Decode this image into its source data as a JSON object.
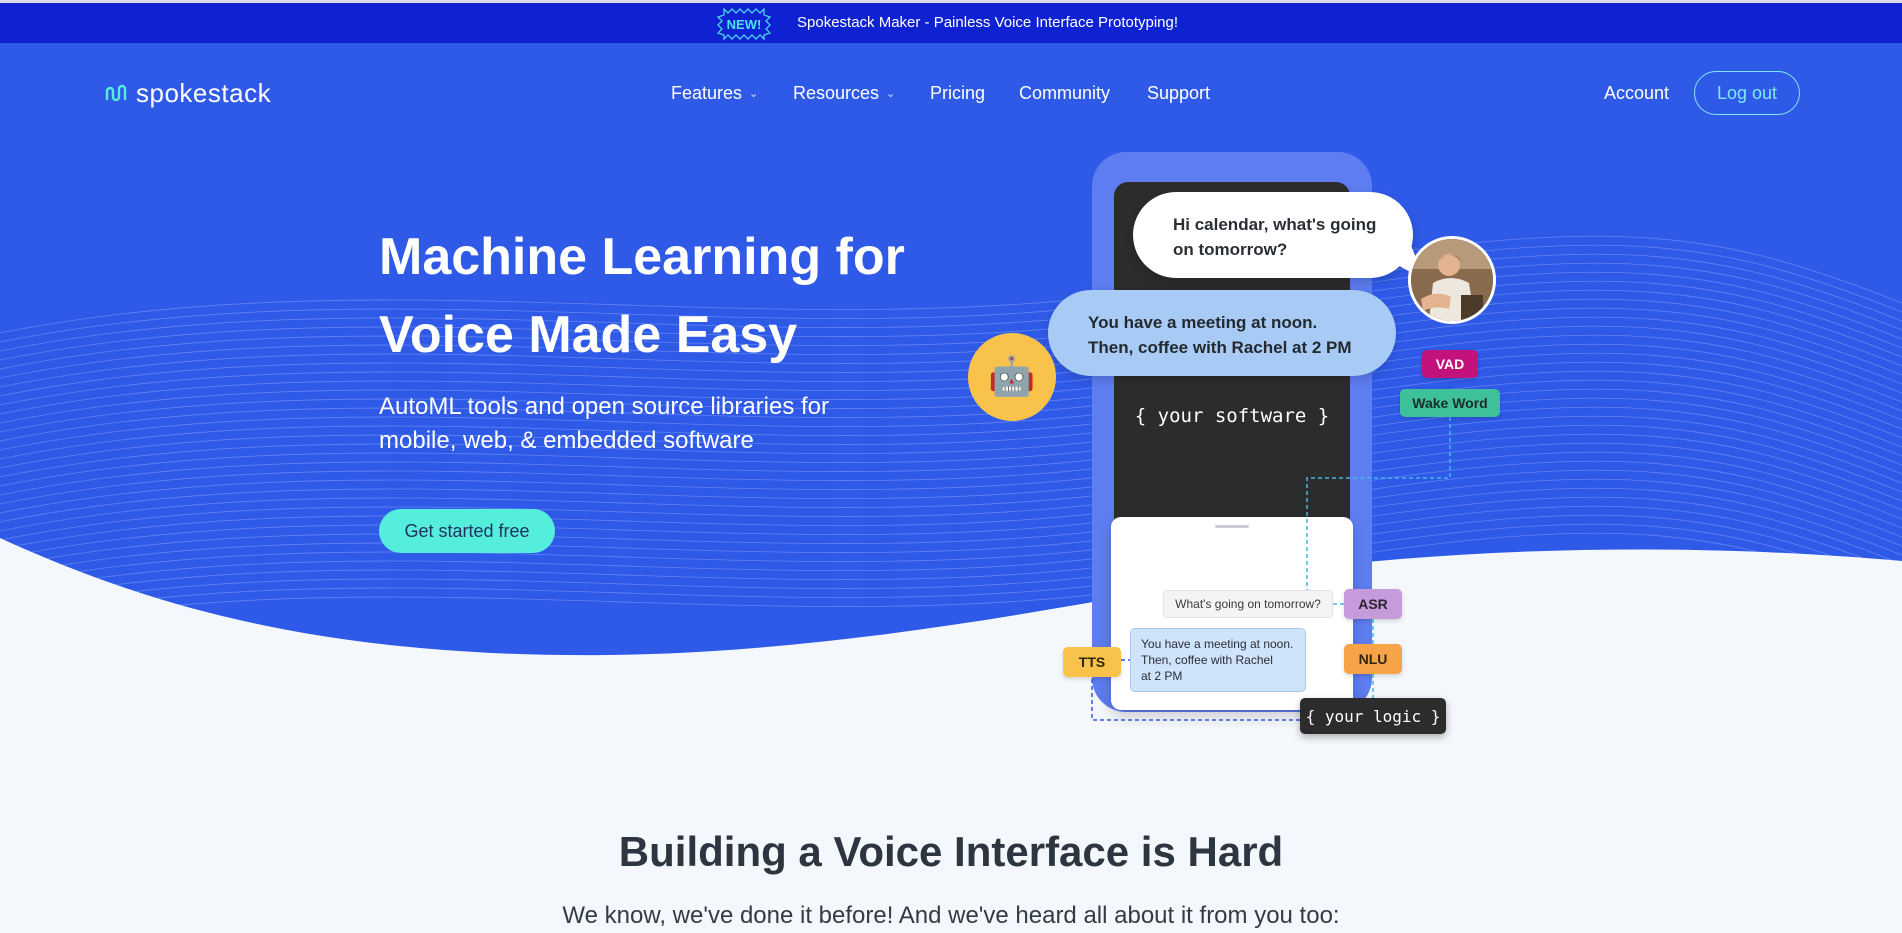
{
  "announcement": {
    "badge": "NEW!",
    "message": "Spokestack Maker - Painless Voice Interface Prototyping!"
  },
  "brand": {
    "name": "spokestack"
  },
  "nav": {
    "items": [
      {
        "label": "Features",
        "dropdown": true
      },
      {
        "label": "Resources",
        "dropdown": true
      },
      {
        "label": "Pricing",
        "dropdown": false
      },
      {
        "label": "Community",
        "dropdown": false
      },
      {
        "label": "Support",
        "dropdown": false
      }
    ],
    "account": "Account",
    "logout": "Log out",
    "chevron": "⌄"
  },
  "hero": {
    "title_line1": "Machine Learning for",
    "title_line2": "Voice Made Easy",
    "subtitle_line1": "AutoML tools and open source libraries for",
    "subtitle_line2": "mobile, web, & embedded software",
    "cta": "Get started free"
  },
  "illustration": {
    "user_bubble_line1": "Hi calendar, what's going",
    "user_bubble_line2": "on tomorrow?",
    "bot_bubble_line1": "You have a meeting at noon.",
    "bot_bubble_line2": "Then, coffee with Rachel at 2 PM",
    "software_label": "{ your software }",
    "chat_question": "What's going on tomorrow?",
    "chat_answer_line1": "You have a meeting at noon.",
    "chat_answer_line2": "Then, coffee with Rachel",
    "chat_answer_line3": "at 2 PM",
    "logic_label": "{ your logic }",
    "bot_avatar": "🤖",
    "tags": {
      "vad": "VAD",
      "wake_word": "Wake Word",
      "asr": "ASR",
      "nlu": "NLU",
      "tts": "TTS"
    }
  },
  "section": {
    "title": "Building a Voice Interface is Hard",
    "subtitle": "We know, we've done it before! And we've heard all about it from you too:"
  },
  "colors": {
    "announcement_bg": "#0f22d1",
    "hero_bg": "#2f5ae8",
    "accent_cyan": "#55eedd",
    "page_bg": "#f4f7fb"
  }
}
